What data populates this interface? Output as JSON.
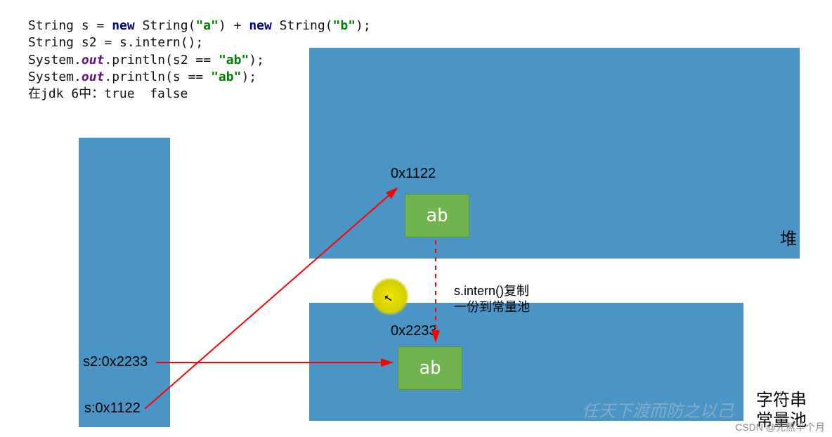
{
  "code": {
    "line1_a": "String s = ",
    "line1_new1": "new",
    "line1_b": " String(",
    "line1_str1": "\"a\"",
    "line1_c": ") + ",
    "line1_new2": "new",
    "line1_d": " String(",
    "line1_str2": "\"b\"",
    "line1_e": ");",
    "line2": "String s2 = s.intern();",
    "line3_a": "System.",
    "line3_out": "out",
    "line3_b": ".println(s2 == ",
    "line3_str": "\"ab\"",
    "line3_c": ");",
    "line4_a": "System.",
    "line4_out": "out",
    "line4_b": ".println(s == ",
    "line4_str": "\"ab\"",
    "line4_c": ");",
    "line5": "在jdk 6中：true  false"
  },
  "boxes": {
    "heap_ab": "ab",
    "pool_ab": "ab"
  },
  "addresses": {
    "heap": "0x1122",
    "pool": "0x2233"
  },
  "stack_labels": {
    "s2": "s2:0x2233",
    "s": "s:0x1122"
  },
  "panels": {
    "heap": "堆",
    "pool": "字符串\n常量池"
  },
  "intern_note": "s.intern()复制\n一份到常量池",
  "watermark": "CSDN @先熬半个月",
  "watermark_faint": "任天下渡而防之以己"
}
